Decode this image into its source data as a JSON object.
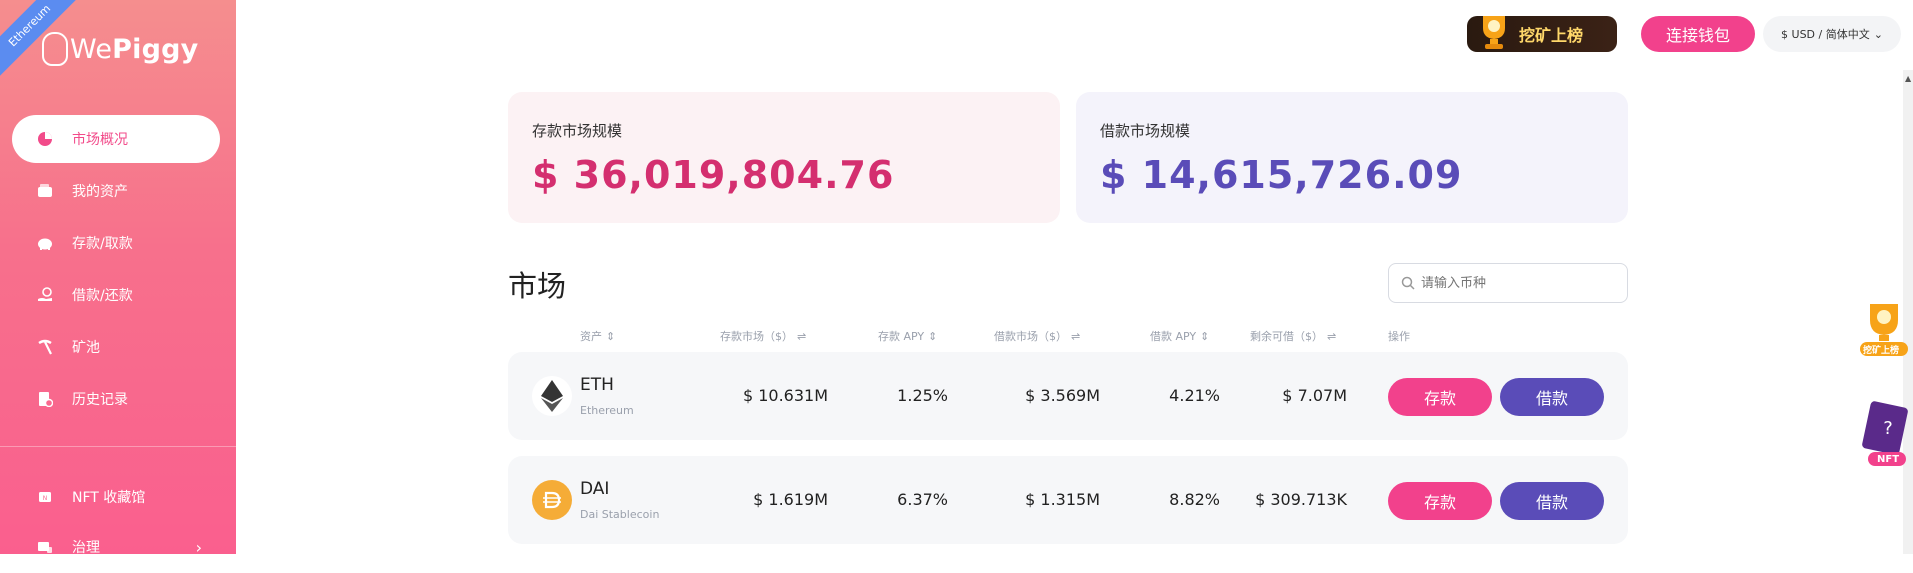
{
  "sidebar": {
    "network": "Ethereum",
    "logo": {
      "we": "We",
      "piggy": "Piggy"
    },
    "items": [
      {
        "label": "市场概况",
        "icon": "pie-chart-icon",
        "active": true
      },
      {
        "label": "我的资产",
        "icon": "wallet-icon"
      },
      {
        "label": "存款/取款",
        "icon": "piggy-bank-icon"
      },
      {
        "label": "借款/还款",
        "icon": "hand-coin-icon"
      },
      {
        "label": "矿池",
        "icon": "pickaxe-icon"
      },
      {
        "label": "历史记录",
        "icon": "history-icon"
      }
    ],
    "extra": [
      {
        "label": "NFT 收藏馆",
        "icon": "nft-icon"
      },
      {
        "label": "治理",
        "icon": "governance-icon",
        "chevron": "›"
      }
    ]
  },
  "header": {
    "mining_badge": "挖矿上榜",
    "connect_label": "连接钱包",
    "lang_label": "$ USD / 简体中文"
  },
  "stats": {
    "deposit_label": "存款市场规模",
    "deposit_value": "$ 36,019,804.76",
    "borrow_label": "借款市场规模",
    "borrow_value": "$ 14,615,726.09"
  },
  "market": {
    "title": "市场",
    "search_placeholder": "请输入币种",
    "columns": {
      "asset": "资产",
      "deposit_market": "存款市场（$）",
      "deposit_apy": "存款 APY",
      "borrow_market": "借款市场（$）",
      "borrow_apy": "借款 APY",
      "available": "剩余可借（$）",
      "actions": "操作"
    },
    "rows": [
      {
        "symbol": "ETH",
        "name": "Ethereum",
        "deposit_market": "$ 10.631M",
        "deposit_apy": "1.25%",
        "borrow_market": "$ 3.569M",
        "borrow_apy": "4.21%",
        "available": "$ 7.07M",
        "deposit_btn": "存款",
        "borrow_btn": "借款"
      },
      {
        "symbol": "DAI",
        "name": "Dai Stablecoin",
        "deposit_market": "$ 1.619M",
        "deposit_apy": "6.37%",
        "borrow_market": "$ 1.315M",
        "borrow_apy": "8.82%",
        "available": "$ 309.713K",
        "deposit_btn": "存款",
        "borrow_btn": "借款"
      }
    ]
  },
  "floating": {
    "mining_label": "挖矿上榜",
    "nft_label": "NFT"
  },
  "colors": {
    "pink": "#f2418c",
    "purple": "#5a4cb8",
    "deposit_value": "#d42f6f"
  }
}
